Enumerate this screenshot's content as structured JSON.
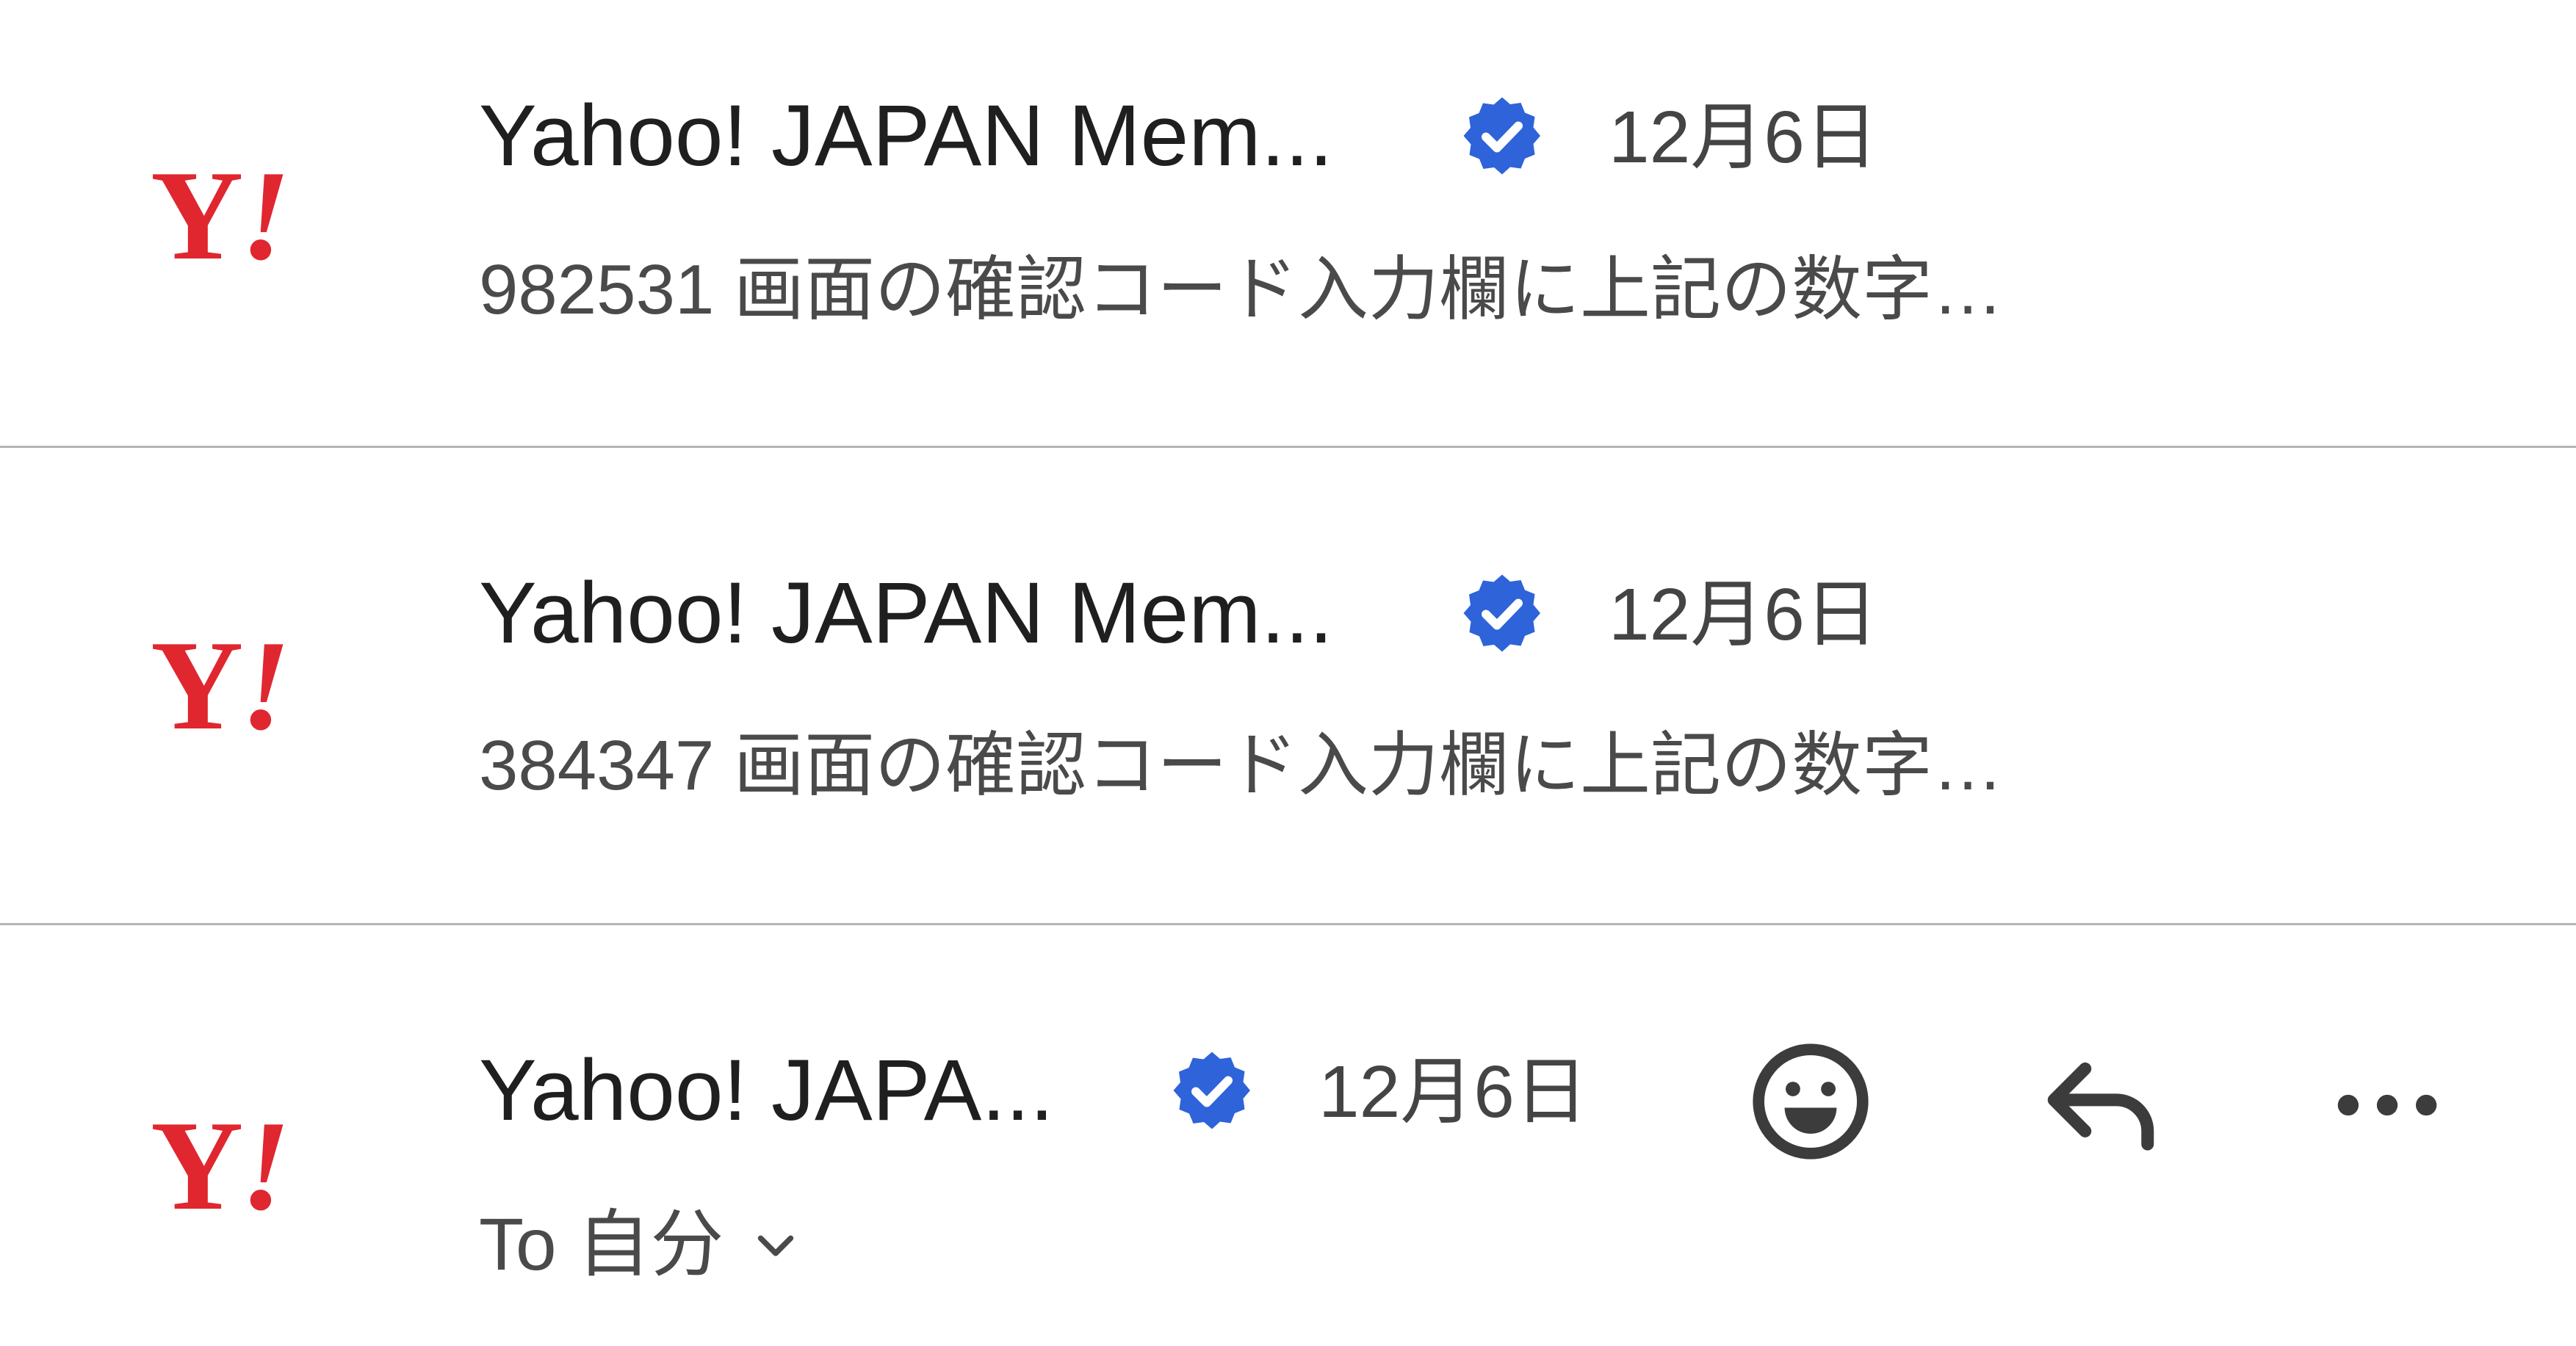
{
  "colors": {
    "brand_red": "#e0262f",
    "verified_blue": "#2e63d9",
    "text_primary": "#1f1f1f",
    "text_secondary": "#4a4a4a",
    "divider": "#b5b5b5"
  },
  "threads": [
    {
      "avatar_text": "Y",
      "avatar_bang": "!",
      "sender": "Yahoo! JAPAN Mem...",
      "verified_icon": "verified-badge-icon",
      "date": "12月6日",
      "snippet": "982531 画面の確認コード入力欄に上記の数字…"
    },
    {
      "avatar_text": "Y",
      "avatar_bang": "!",
      "sender": "Yahoo! JAPAN Mem...",
      "verified_icon": "verified-badge-icon",
      "date": "12月6日",
      "snippet": "384347 画面の確認コード入力欄に上記の数字…"
    },
    {
      "avatar_text": "Y",
      "avatar_bang": "!",
      "sender": "Yahoo! JAPA...",
      "verified_icon": "verified-badge-icon",
      "date": "12月6日",
      "recipient_line": "To 自分",
      "actions": {
        "emoji_icon": "emoji-smile-icon",
        "reply_icon": "reply-icon",
        "more_icon": "more-horizontal-icon"
      }
    }
  ]
}
